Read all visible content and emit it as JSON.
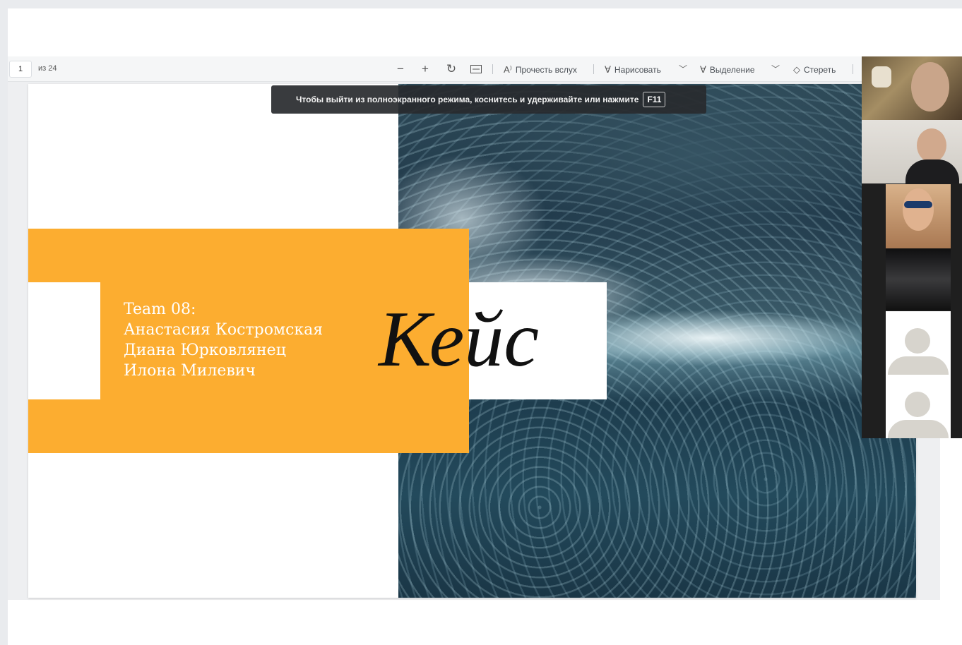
{
  "toolbar": {
    "page_current": "1",
    "page_total": "из 24",
    "zoom_out_icon": "minus-icon",
    "zoom_in_icon": "plus-icon",
    "rotate_icon": "rotate-icon",
    "fit_icon": "fit-page-icon",
    "read_aloud": "Прочесть вслух",
    "draw": "Нарисовать",
    "highlight": "Выделение",
    "erase": "Стереть"
  },
  "toast": {
    "message": "Чтобы выйти из полноэкранного режима, коснитесь и удерживайте или нажмите",
    "key": "F11"
  },
  "slide": {
    "title": "Кейс",
    "team_lines": [
      "Team 08:",
      "Анастасия Костромская",
      "Диана Юрковлянец",
      "Илона Милевич"
    ],
    "colors": {
      "accent": "#fcad30",
      "ocean": "#20394a"
    }
  },
  "video_panel": {
    "participants": [
      {
        "kind": "camera"
      },
      {
        "kind": "camera"
      },
      {
        "kind": "camera"
      },
      {
        "kind": "screen"
      },
      {
        "kind": "avatar"
      },
      {
        "kind": "avatar"
      }
    ]
  }
}
